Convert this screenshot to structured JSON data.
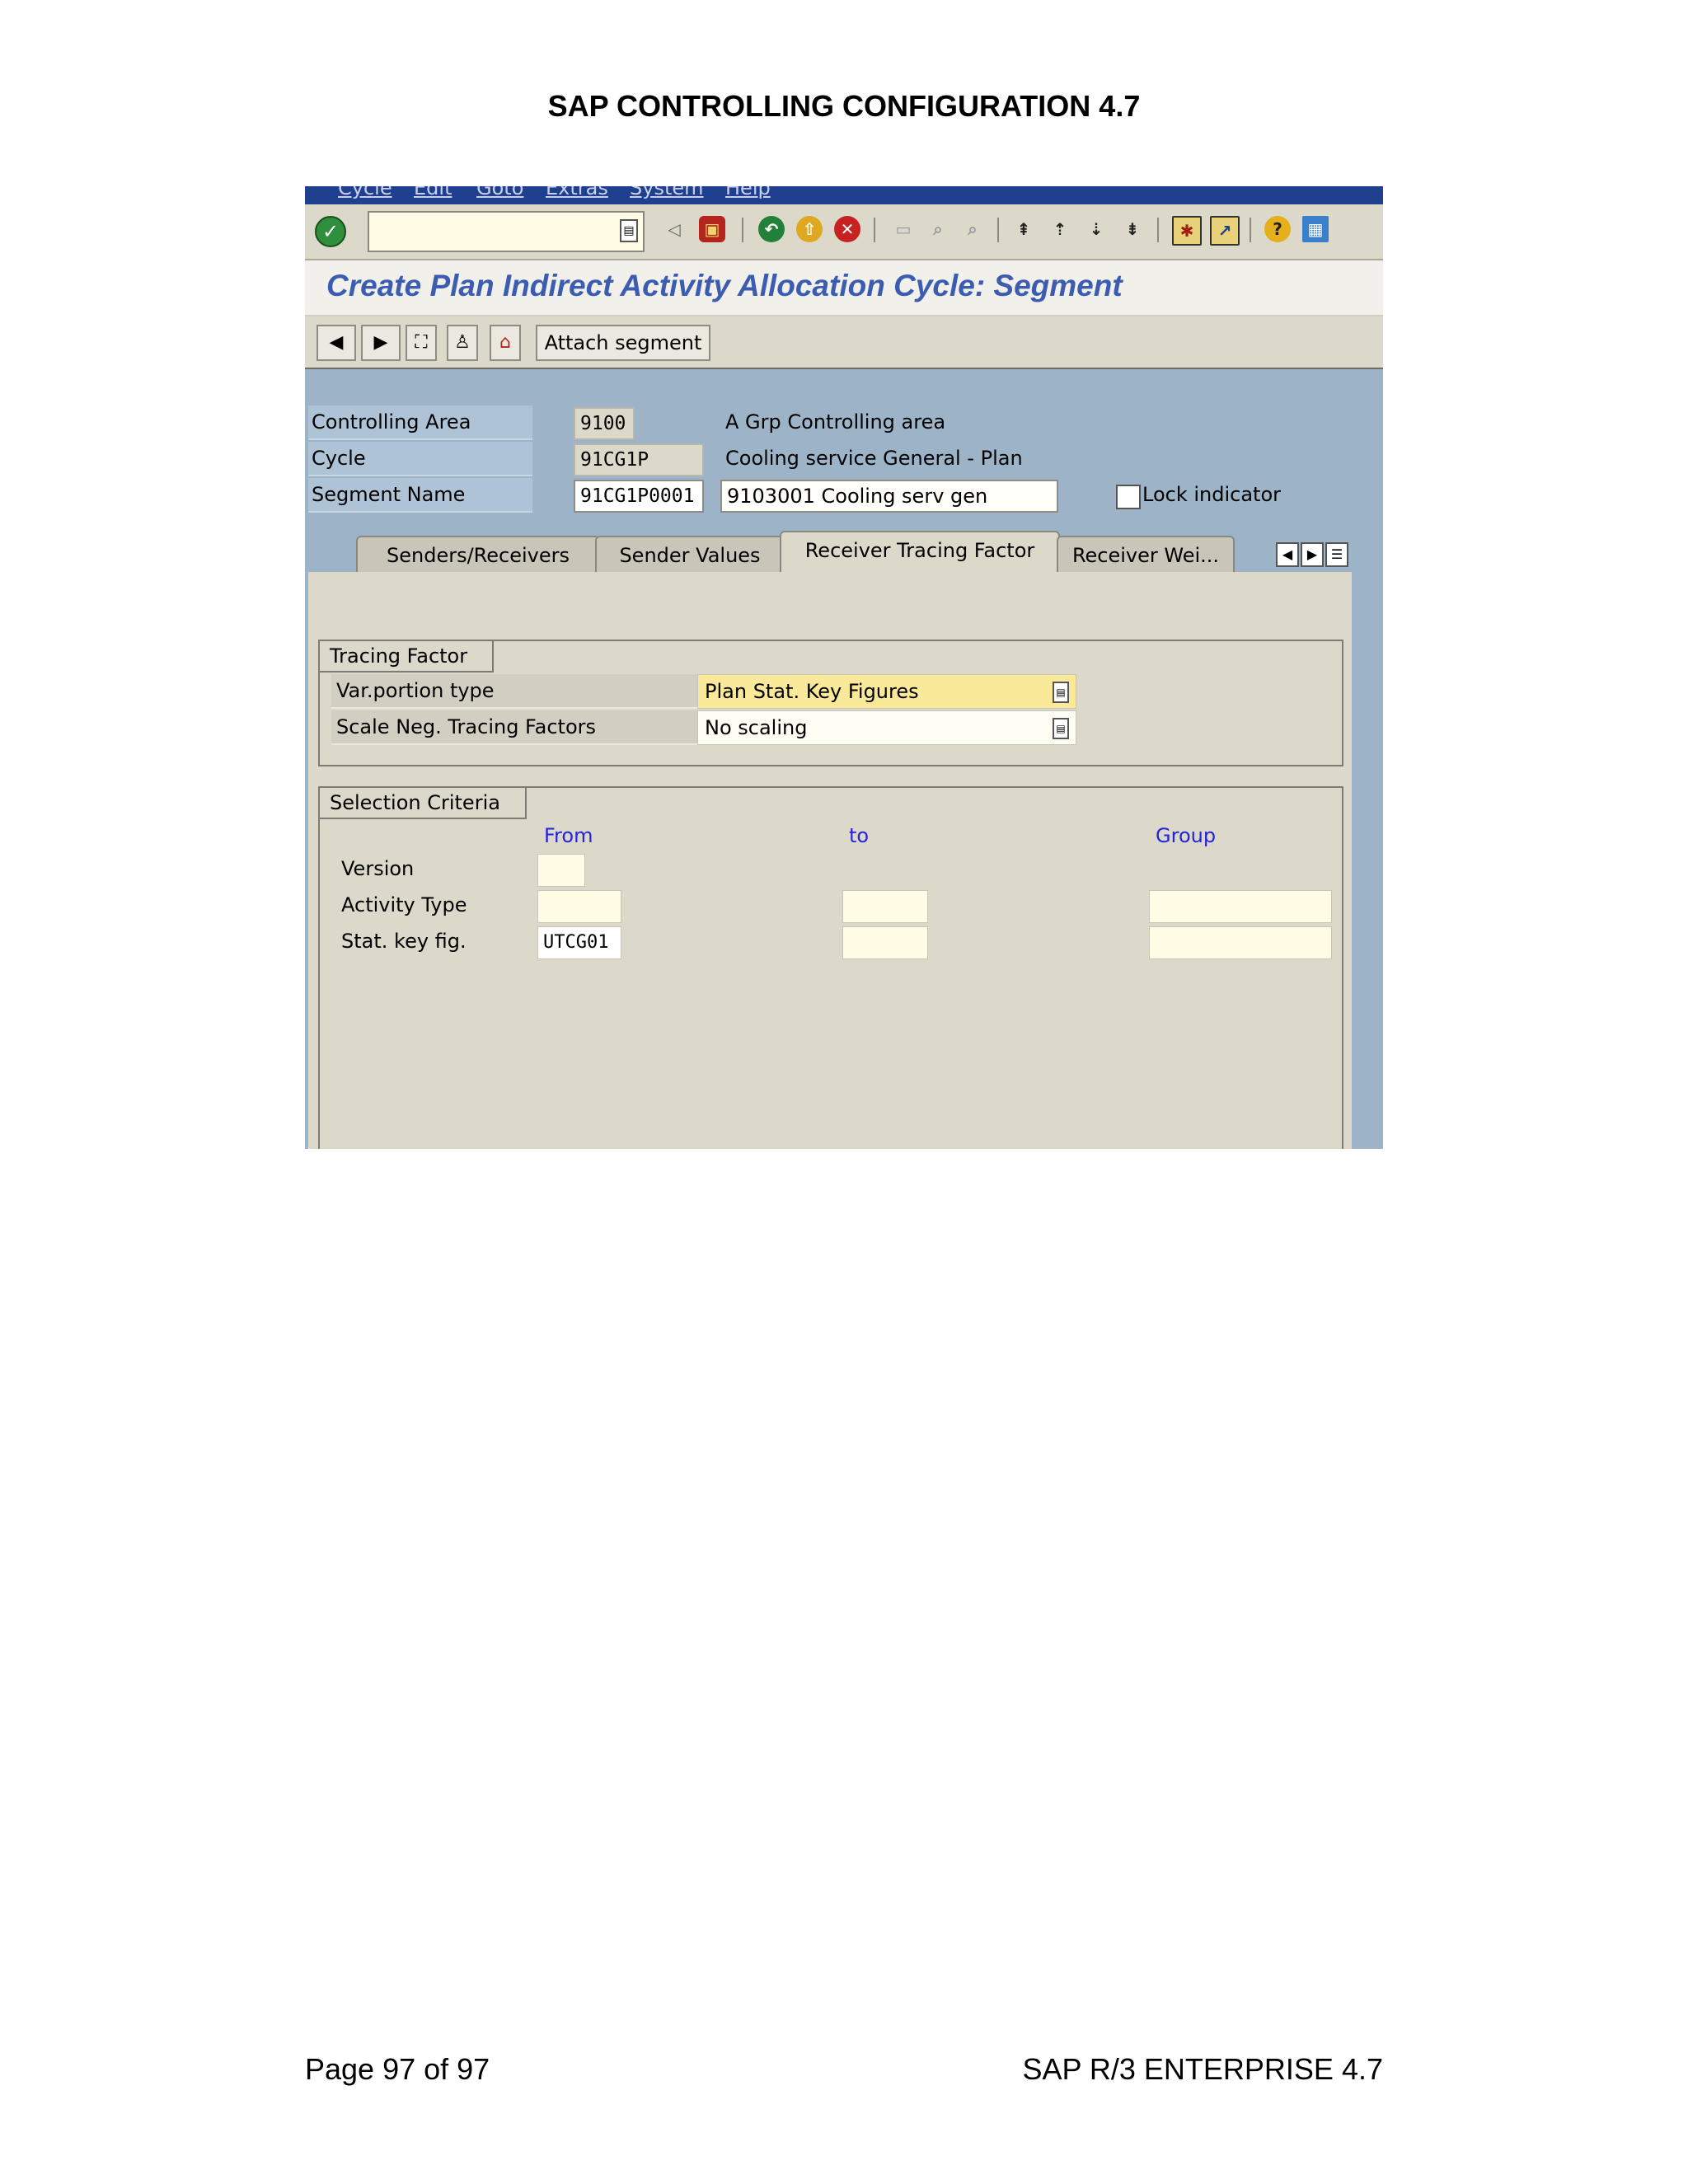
{
  "document": {
    "header": "SAP CONTROLLING CONFIGURATION 4.7",
    "footer_left": "Page 97 of 97",
    "footer_right": "SAP R/3 ENTERPRISE 4.7"
  },
  "menu": [
    "Cycle",
    "Edit",
    "Goto",
    "Extras",
    "System",
    "Help"
  ],
  "screen_title": "Create Plan Indirect Activity Allocation Cycle: Segment",
  "app_toolbar": {
    "attach_label": "Attach segment"
  },
  "header_fields": {
    "controlling_area": {
      "label": "Controlling Area",
      "value": "9100",
      "description": "A Grp Controlling area"
    },
    "cycle": {
      "label": "Cycle",
      "value": "91CG1P",
      "description": "Cooling service General - Plan"
    },
    "segment_name": {
      "label": "Segment Name",
      "value": "91CG1P0001",
      "description": "9103001 Cooling serv gen"
    },
    "lock_indicator": {
      "label": "Lock indicator",
      "checked": false
    }
  },
  "tabs": [
    "Senders/Receivers",
    "Sender Values",
    "Receiver Tracing Factor",
    "Receiver Wei..."
  ],
  "active_tab": "Receiver Tracing Factor",
  "tracing_factor": {
    "title": "Tracing Factor",
    "var_portion_type": {
      "label": "Var.portion type",
      "value": "Plan Stat. Key Figures"
    },
    "scale_neg": {
      "label": "Scale Neg. Tracing Factors",
      "value": "No scaling"
    }
  },
  "selection_criteria": {
    "title": "Selection Criteria",
    "columns": {
      "from": "From",
      "to": "to",
      "group": "Group"
    },
    "rows": [
      {
        "label": "Version",
        "from": "",
        "to": null,
        "group": null
      },
      {
        "label": "Activity Type",
        "from": "",
        "to": "",
        "group": ""
      },
      {
        "label": "Stat. key fig.",
        "from": "UTCG01",
        "to": "",
        "group": ""
      }
    ]
  },
  "colors": {
    "menubar": "#1f3f8f",
    "title": "#3b5cb0",
    "header_area": "#9db4c8",
    "column_header": "#2323e0",
    "focused_field": "#fbe99a"
  }
}
